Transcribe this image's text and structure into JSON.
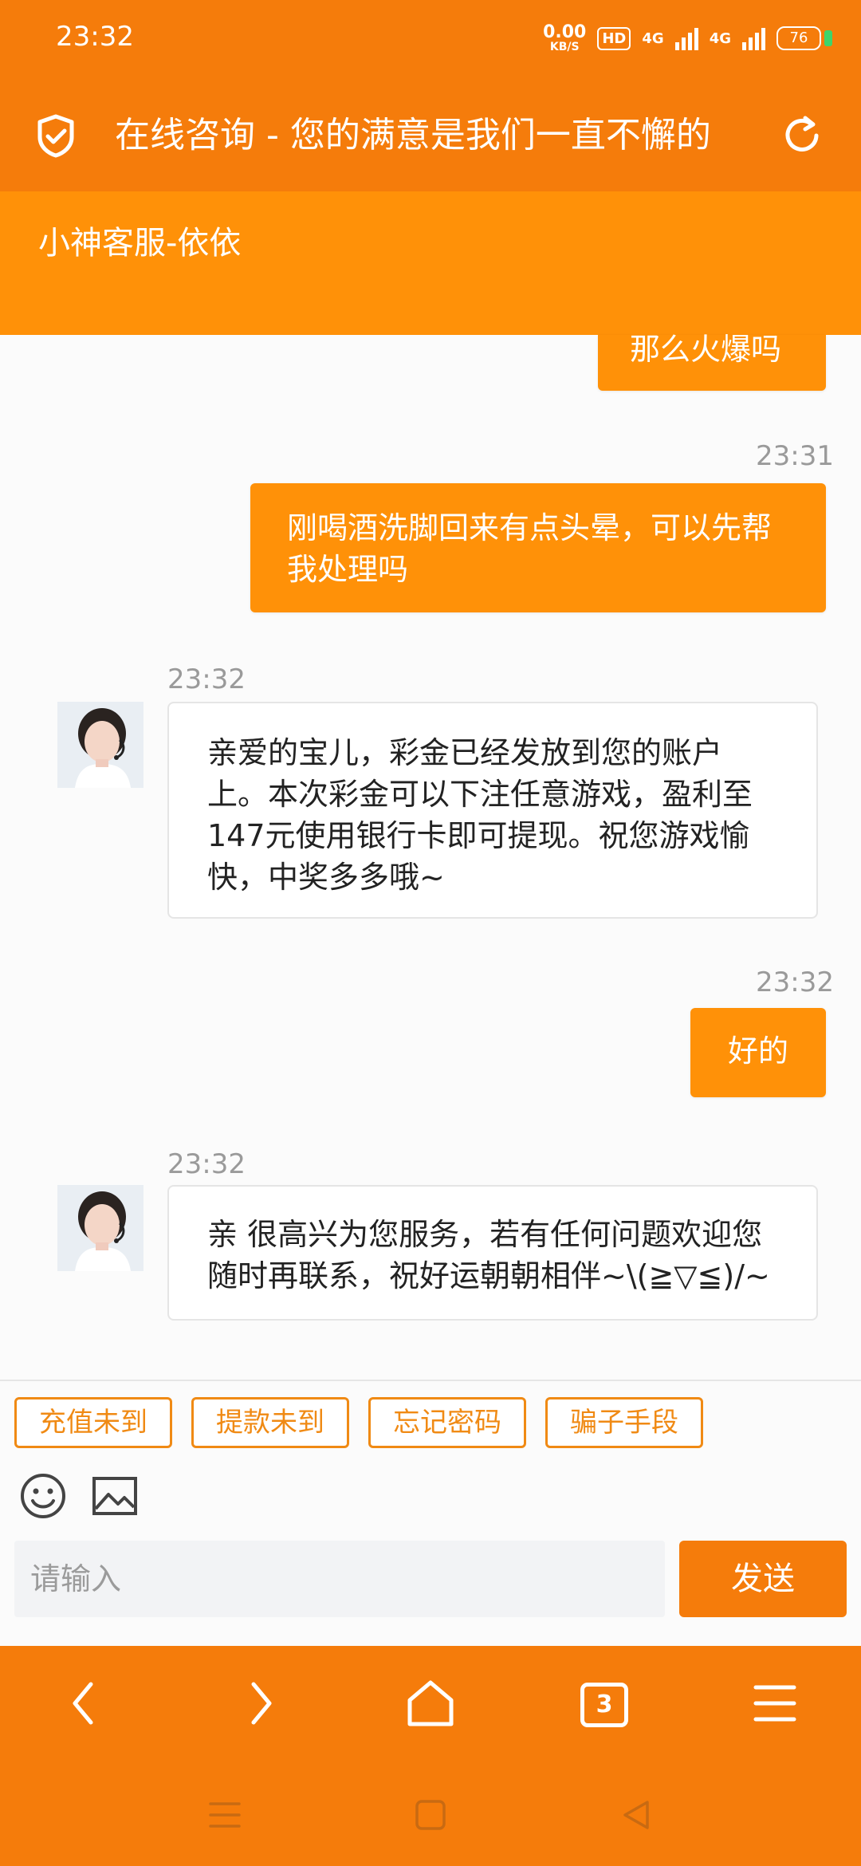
{
  "status_bar": {
    "time": "23:32",
    "net_speed": "0.00",
    "net_unit": "KB/S",
    "hd": "HD",
    "net1": "4G",
    "net2": "4G",
    "battery": "76"
  },
  "browser": {
    "title": "在线咨询 - 您的满意是我们一直不懈的",
    "shield_icon": "shield-check-icon",
    "reload_icon": "reload-icon",
    "tab_count": "3"
  },
  "agent": {
    "name": "小神客服-依依"
  },
  "messages": [
    {
      "from": "me",
      "time": "",
      "text": "那么火爆吗"
    },
    {
      "from": "me",
      "time": "23:31",
      "text": "刚喝酒洗脚回来有点头晕，可以先帮我处理吗"
    },
    {
      "from": "agent",
      "time": "23:32",
      "text": "亲爱的宝儿，彩金已经发放到您的账户上。本次彩金可以下注任意游戏，盈利至147元使用银行卡即可提现。祝您游戏愉快，中奖多多哦~"
    },
    {
      "from": "me",
      "time": "23:32",
      "text": "好的"
    },
    {
      "from": "agent",
      "time": "23:32",
      "text": "亲 很高兴为您服务，若有任何问题欢迎您随时再联系，祝好运朝朝相伴~\\(≧▽≦)/~"
    }
  ],
  "quick_replies": [
    "充值未到",
    "提款未到",
    "忘记密码",
    "骗子手段"
  ],
  "input": {
    "placeholder": "请输入",
    "value": ""
  },
  "send_label": "发送",
  "colors": {
    "primary": "#f57c0b",
    "header": "#ff9108",
    "bubble_me": "#ff9108",
    "quick_border": "#f08a14"
  }
}
